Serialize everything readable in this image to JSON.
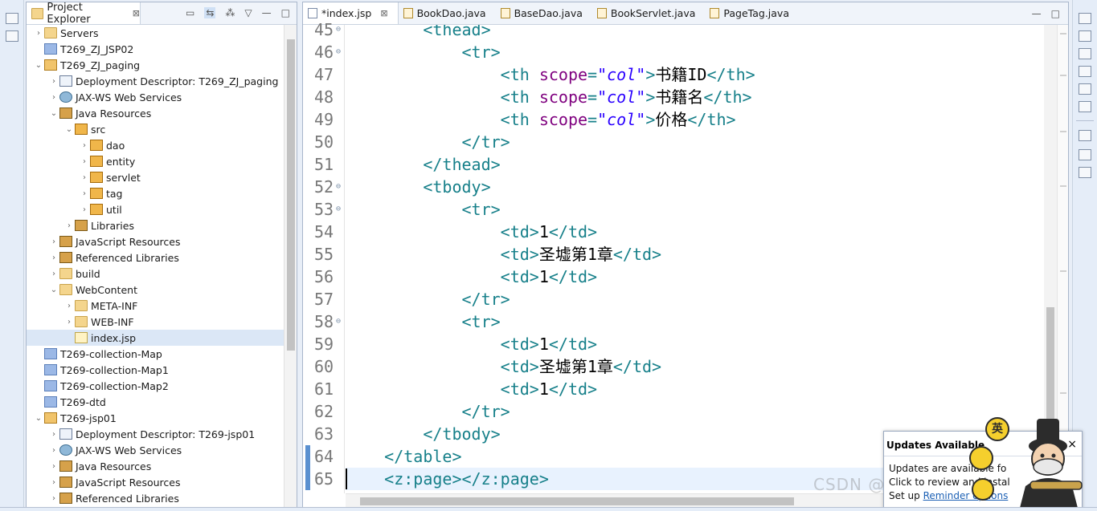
{
  "explorer": {
    "title": "Project Explorer",
    "rows": [
      {
        "indent": 0,
        "arrow": "›",
        "icon": "i-folder",
        "label": "Servers"
      },
      {
        "indent": 0,
        "arrow": "",
        "icon": "i-project",
        "label": "T269_ZJ_JSP02"
      },
      {
        "indent": 0,
        "arrow": "⌄",
        "icon": "i-web",
        "label": "T269_ZJ_paging"
      },
      {
        "indent": 1,
        "arrow": "›",
        "icon": "i-dd",
        "label": "Deployment Descriptor: T269_ZJ_paging"
      },
      {
        "indent": 1,
        "arrow": "›",
        "icon": "i-globe",
        "label": "JAX-WS Web Services"
      },
      {
        "indent": 1,
        "arrow": "⌄",
        "icon": "i-lib",
        "label": "Java Resources"
      },
      {
        "indent": 2,
        "arrow": "⌄",
        "icon": "i-pkg",
        "label": "src"
      },
      {
        "indent": 3,
        "arrow": "›",
        "icon": "i-pkg",
        "label": "dao"
      },
      {
        "indent": 3,
        "arrow": "›",
        "icon": "i-pkg",
        "label": "entity"
      },
      {
        "indent": 3,
        "arrow": "›",
        "icon": "i-pkg",
        "label": "servlet"
      },
      {
        "indent": 3,
        "arrow": "›",
        "icon": "i-pkg",
        "label": "tag"
      },
      {
        "indent": 3,
        "arrow": "›",
        "icon": "i-pkg",
        "label": "util"
      },
      {
        "indent": 2,
        "arrow": "›",
        "icon": "i-lib",
        "label": "Libraries"
      },
      {
        "indent": 1,
        "arrow": "›",
        "icon": "i-lib",
        "label": "JavaScript Resources"
      },
      {
        "indent": 1,
        "arrow": "›",
        "icon": "i-lib",
        "label": "Referenced Libraries"
      },
      {
        "indent": 1,
        "arrow": "›",
        "icon": "i-folder",
        "label": "build"
      },
      {
        "indent": 1,
        "arrow": "⌄",
        "icon": "i-folder",
        "label": "WebContent"
      },
      {
        "indent": 2,
        "arrow": "›",
        "icon": "i-folder",
        "label": "META-INF"
      },
      {
        "indent": 2,
        "arrow": "›",
        "icon": "i-folder",
        "label": "WEB-INF"
      },
      {
        "indent": 2,
        "arrow": "",
        "icon": "i-file",
        "label": "index.jsp",
        "selected": true
      },
      {
        "indent": 0,
        "arrow": "",
        "icon": "i-project",
        "label": "T269-collection-Map"
      },
      {
        "indent": 0,
        "arrow": "",
        "icon": "i-project",
        "label": "T269-collection-Map1"
      },
      {
        "indent": 0,
        "arrow": "",
        "icon": "i-project",
        "label": "T269-collection-Map2"
      },
      {
        "indent": 0,
        "arrow": "",
        "icon": "i-project",
        "label": "T269-dtd"
      },
      {
        "indent": 0,
        "arrow": "⌄",
        "icon": "i-web",
        "label": "T269-jsp01"
      },
      {
        "indent": 1,
        "arrow": "›",
        "icon": "i-dd",
        "label": "Deployment Descriptor: T269-jsp01"
      },
      {
        "indent": 1,
        "arrow": "›",
        "icon": "i-globe",
        "label": "JAX-WS Web Services"
      },
      {
        "indent": 1,
        "arrow": "›",
        "icon": "i-lib",
        "label": "Java Resources"
      },
      {
        "indent": 1,
        "arrow": "›",
        "icon": "i-lib",
        "label": "JavaScript Resources"
      },
      {
        "indent": 1,
        "arrow": "›",
        "icon": "i-lib",
        "label": "Referenced Libraries"
      }
    ]
  },
  "editor": {
    "tabs": [
      {
        "label": "*index.jsp",
        "active": true,
        "icon": "jsp",
        "closable": true
      },
      {
        "label": "BookDao.java",
        "icon": "java"
      },
      {
        "label": "BaseDao.java",
        "icon": "java"
      },
      {
        "label": "BookServlet.java",
        "icon": "java"
      },
      {
        "label": "PageTag.java",
        "icon": "java"
      }
    ],
    "lines": [
      {
        "num": "45",
        "fold": true,
        "indent": "        ",
        "parts": [
          [
            "tag",
            "<thead>"
          ]
        ]
      },
      {
        "num": "46",
        "fold": true,
        "indent": "            ",
        "parts": [
          [
            "tag",
            "<tr>"
          ]
        ]
      },
      {
        "num": "47",
        "indent": "                ",
        "parts": [
          [
            "tag",
            "<th "
          ],
          [
            "attr",
            "scope"
          ],
          [
            "tag",
            "="
          ],
          [
            "val",
            "\"col\""
          ],
          [
            "tag",
            ">"
          ],
          [
            "txt",
            "书籍ID"
          ],
          [
            "tag",
            "</th>"
          ]
        ]
      },
      {
        "num": "48",
        "indent": "                ",
        "parts": [
          [
            "tag",
            "<th "
          ],
          [
            "attr",
            "scope"
          ],
          [
            "tag",
            "="
          ],
          [
            "val",
            "\"col\""
          ],
          [
            "tag",
            ">"
          ],
          [
            "txt",
            "书籍名"
          ],
          [
            "tag",
            "</th>"
          ]
        ]
      },
      {
        "num": "49",
        "indent": "                ",
        "parts": [
          [
            "tag",
            "<th "
          ],
          [
            "attr",
            "scope"
          ],
          [
            "tag",
            "="
          ],
          [
            "val",
            "\"col\""
          ],
          [
            "tag",
            ">"
          ],
          [
            "txt",
            "价格"
          ],
          [
            "tag",
            "</th>"
          ]
        ]
      },
      {
        "num": "50",
        "indent": "            ",
        "parts": [
          [
            "tag",
            "</tr>"
          ]
        ]
      },
      {
        "num": "51",
        "indent": "        ",
        "parts": [
          [
            "tag",
            "</thead>"
          ]
        ]
      },
      {
        "num": "52",
        "fold": true,
        "indent": "        ",
        "parts": [
          [
            "tag",
            "<tbody>"
          ]
        ]
      },
      {
        "num": "53",
        "fold": true,
        "indent": "            ",
        "parts": [
          [
            "tag",
            "<tr>"
          ]
        ]
      },
      {
        "num": "54",
        "indent": "                ",
        "parts": [
          [
            "tag",
            "<td>"
          ],
          [
            "txt",
            "1"
          ],
          [
            "tag",
            "</td>"
          ]
        ]
      },
      {
        "num": "55",
        "indent": "                ",
        "parts": [
          [
            "tag",
            "<td>"
          ],
          [
            "txt",
            "圣墟第1章"
          ],
          [
            "tag",
            "</td>"
          ]
        ]
      },
      {
        "num": "56",
        "indent": "                ",
        "parts": [
          [
            "tag",
            "<td>"
          ],
          [
            "txt",
            "1"
          ],
          [
            "tag",
            "</td>"
          ]
        ]
      },
      {
        "num": "57",
        "indent": "            ",
        "parts": [
          [
            "tag",
            "</tr>"
          ]
        ]
      },
      {
        "num": "58",
        "fold": true,
        "indent": "            ",
        "parts": [
          [
            "tag",
            "<tr>"
          ]
        ]
      },
      {
        "num": "59",
        "indent": "                ",
        "parts": [
          [
            "tag",
            "<td>"
          ],
          [
            "txt",
            "1"
          ],
          [
            "tag",
            "</td>"
          ]
        ]
      },
      {
        "num": "60",
        "indent": "                ",
        "parts": [
          [
            "tag",
            "<td>"
          ],
          [
            "txt",
            "圣墟第1章"
          ],
          [
            "tag",
            "</td>"
          ]
        ]
      },
      {
        "num": "61",
        "indent": "                ",
        "parts": [
          [
            "tag",
            "<td>"
          ],
          [
            "txt",
            "1"
          ],
          [
            "tag",
            "</td>"
          ]
        ]
      },
      {
        "num": "62",
        "indent": "            ",
        "parts": [
          [
            "tag",
            "</tr>"
          ]
        ]
      },
      {
        "num": "63",
        "indent": "        ",
        "parts": [
          [
            "tag",
            "</tbody>"
          ]
        ]
      },
      {
        "num": "64",
        "mark": true,
        "indent": "    ",
        "parts": [
          [
            "tag",
            "</table>"
          ]
        ]
      },
      {
        "num": "65",
        "mark": true,
        "current": true,
        "indent": "    ",
        "parts": [
          [
            "tag",
            "<z:page></z:page>"
          ]
        ]
      }
    ]
  },
  "notification": {
    "title": "Updates Available",
    "close": "×",
    "line1": "Updates are available fo",
    "line2": "Click to review and instal",
    "line3_prefix": "Set up ",
    "line3_link": "Reminder options"
  },
  "mascot": {
    "badge": "英"
  },
  "watermark": "CSDN @java_zhj"
}
